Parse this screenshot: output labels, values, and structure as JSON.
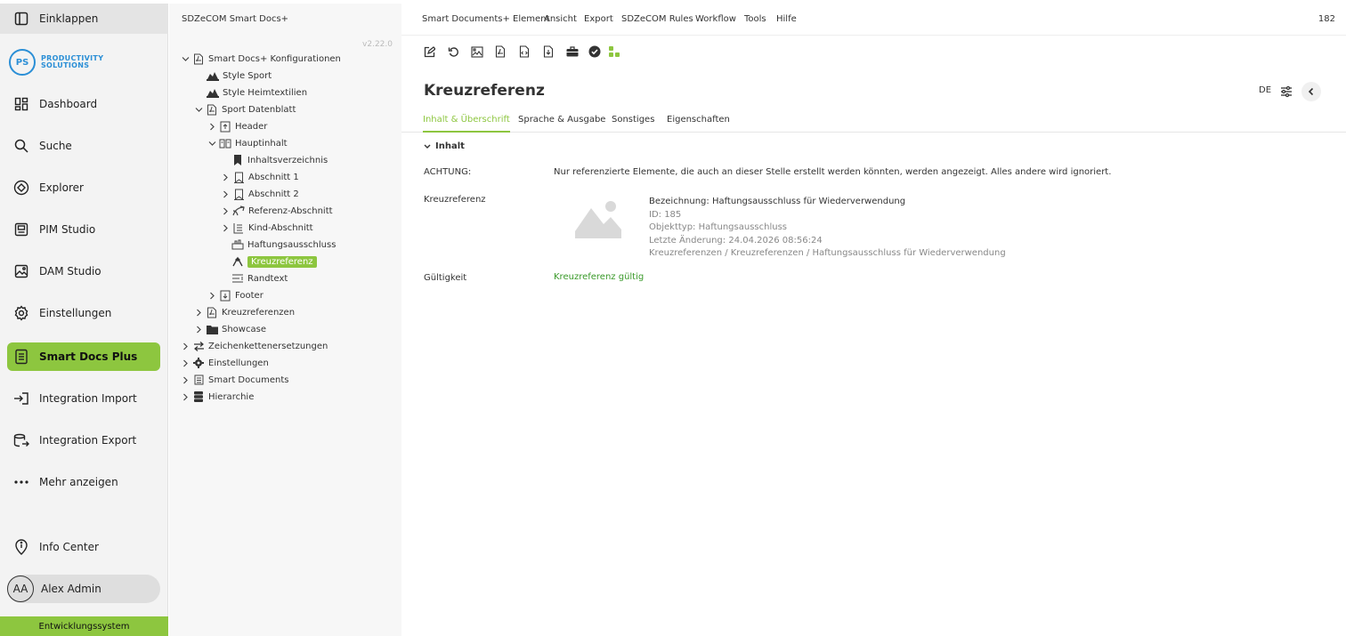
{
  "nav": {
    "collapse": "Einklappen",
    "logo": {
      "badge": "PS",
      "line1": "PRODUCTIVITY",
      "line2": "SOLUTIONS"
    },
    "items": [
      {
        "label": "Dashboard",
        "icon": "dashboard-icon"
      },
      {
        "label": "Suche",
        "icon": "search-icon"
      },
      {
        "label": "Explorer",
        "icon": "explorer-icon"
      },
      {
        "label": "PIM Studio",
        "icon": "pim-icon"
      },
      {
        "label": "DAM Studio",
        "icon": "image-icon"
      },
      {
        "label": "Einstellungen",
        "icon": "gear-icon"
      },
      {
        "label": "Smart Docs Plus",
        "icon": "document-icon"
      },
      {
        "label": "Integration Import",
        "icon": "import-icon"
      },
      {
        "label": "Integration Export",
        "icon": "export-icon"
      },
      {
        "label": "Mehr anzeigen",
        "icon": "more-icon"
      }
    ],
    "info_center": "Info Center",
    "user": {
      "initials": "AA",
      "name": "Alex Admin"
    },
    "environment": "Entwicklungssystem",
    "accent_color": "#8dc63f"
  },
  "tree": {
    "title": "SDZeCOM Smart Docs+",
    "version": "v2.22.0",
    "nodes": [
      {
        "label": "Smart Docs+ Konfigurationen"
      },
      {
        "label": "Style Sport"
      },
      {
        "label": "Style Heimtextilien"
      },
      {
        "label": "Sport Datenblatt"
      },
      {
        "label": "Header"
      },
      {
        "label": "Hauptinhalt"
      },
      {
        "label": "Inhaltsverzeichnis"
      },
      {
        "label": "Abschnitt 1"
      },
      {
        "label": "Abschnitt 2"
      },
      {
        "label": "Referenz-Abschnitt"
      },
      {
        "label": "Kind-Abschnitt"
      },
      {
        "label": "Haftungsausschluss"
      },
      {
        "label": "Kreuzreferenz"
      },
      {
        "label": "Randtext"
      },
      {
        "label": "Footer"
      },
      {
        "label": "Kreuzreferenzen"
      },
      {
        "label": "Showcase"
      },
      {
        "label": "Zeichenkettenersetzungen"
      },
      {
        "label": "Einstellungen"
      },
      {
        "label": "Smart Documents"
      },
      {
        "label": "Hierarchie"
      }
    ]
  },
  "menu": {
    "items": [
      "Smart Documents+ Element",
      "Ansicht",
      "Export",
      "SDZeCOM Rules",
      "Workflow",
      "Tools",
      "Hilfe"
    ],
    "count": "182"
  },
  "page": {
    "title": "Kreuzreferenz",
    "language": "DE",
    "tabs": [
      "Inhalt & Überschrift",
      "Sprache & Ausgabe",
      "Sonstiges",
      "Eigenschaften"
    ],
    "section": "Inhalt",
    "warning_label": "ACHTUNG:",
    "warning_text": "Nur referenzierte Elemente, die auch an dieser Stelle erstellt werden könnten, werden angezeigt. Alles andere wird ignoriert.",
    "ref_label": "Kreuzreferenz",
    "ref": {
      "bezeichnung": "Bezeichnung: Haftungsausschluss für Wiederverwendung",
      "id": "ID: 185",
      "objekttyp": "Objekttyp: Haftungsausschluss",
      "aenderung": "Letzte Änderung: 24.04.2026 08:56:24",
      "pfad": "Kreuzreferenzen / Kreuzreferenzen / Haftungsausschluss für Wiederverwendung"
    },
    "validity_label": "Gültigkeit",
    "validity_value": "Kreuzreferenz gültig"
  }
}
